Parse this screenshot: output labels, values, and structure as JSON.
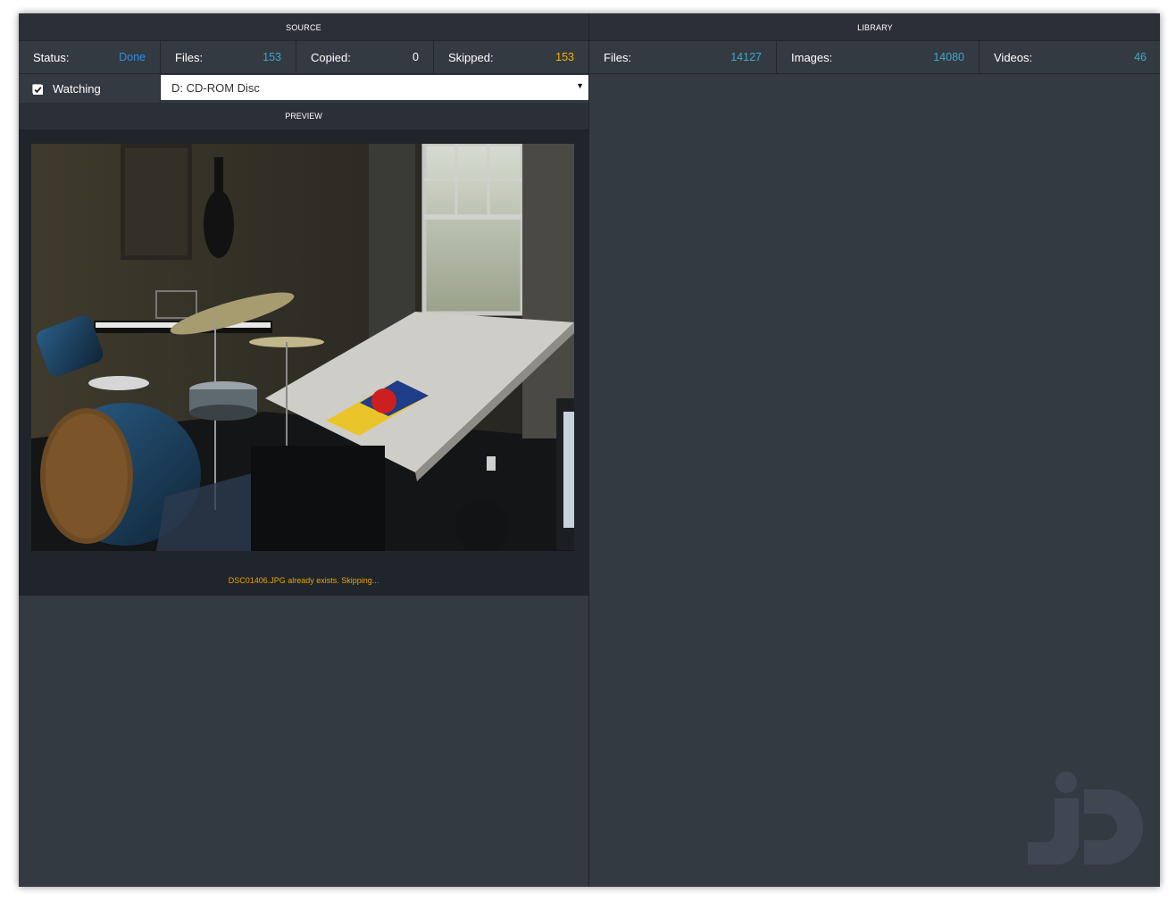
{
  "source": {
    "header": "SOURCE",
    "stats": [
      {
        "label": "Status:",
        "value": "Done",
        "color": "#2f8ee6"
      },
      {
        "label": "Files:",
        "value": "153",
        "color": "#3da8c9"
      },
      {
        "label": "Copied:",
        "value": "0",
        "color": "#ffffff"
      },
      {
        "label": "Skipped:",
        "value": "153",
        "color": "#f0b400"
      }
    ],
    "watch_label": "Watching",
    "watch_checked": true,
    "drive_select": "D: CD-ROM Disc"
  },
  "preview": {
    "header": "PREVIEW",
    "message": "DSC01406.JPG already exists. Skipping..."
  },
  "library": {
    "header": "LIBRARY",
    "stats": [
      {
        "label": "Files:",
        "value": "14127",
        "color": "#3da8c9"
      },
      {
        "label": "Images:",
        "value": "14080",
        "color": "#3da8c9"
      },
      {
        "label": "Videos:",
        "value": "46",
        "color": "#3da8c9"
      }
    ]
  },
  "colors": {
    "background": "#343a42",
    "header": "#2b3038",
    "warning": "#e8a400"
  },
  "icons": {
    "checkbox": "check-icon",
    "dropdown": "chevron-down-icon",
    "logo": "jd-logo-icon"
  }
}
